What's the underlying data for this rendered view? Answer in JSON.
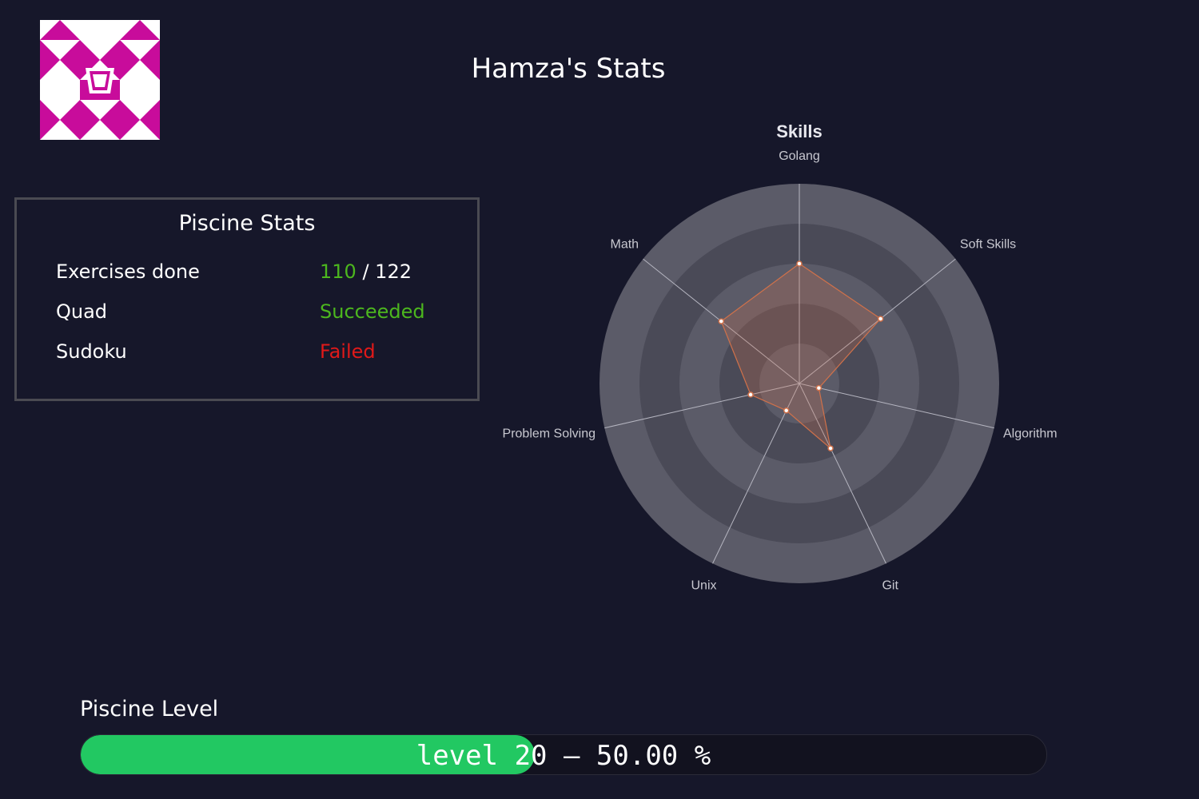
{
  "page": {
    "title": "Hamza's Stats"
  },
  "avatar": {
    "icon": "identicon-avatar",
    "color": "#c80c9b"
  },
  "piscine_stats": {
    "title": "Piscine Stats",
    "rows": [
      {
        "label": "Exercises done",
        "value": "110",
        "separator": "/ 122",
        "status": "normal"
      },
      {
        "label": "Quad",
        "value": "Succeeded",
        "status": "success"
      },
      {
        "label": "Sudoku",
        "value": "Failed",
        "status": "fail"
      }
    ]
  },
  "chart_data": {
    "type": "radar",
    "title": "Skills",
    "categories": [
      "Golang",
      "Soft Skills",
      "Algorithm",
      "Git",
      "Unix",
      "Problem Solving",
      "Math"
    ],
    "series": [
      {
        "values": [
          60,
          52,
          10,
          36,
          15,
          25,
          50
        ]
      }
    ],
    "rmax": 100,
    "rings": 5,
    "grid": true,
    "colors": {
      "series_line": "#d0714a",
      "series_fill": "rgba(208,113,74,0.25)",
      "ring_light": "#5b5b68",
      "ring_dark": "#4a4a57",
      "spoke": "#b5b5c0",
      "label": "#c8c8d0"
    }
  },
  "level": {
    "label": "Piscine Level",
    "text": "level 20 – 50.00 %",
    "progress_percent": 47,
    "fill_color": "#22c862"
  }
}
